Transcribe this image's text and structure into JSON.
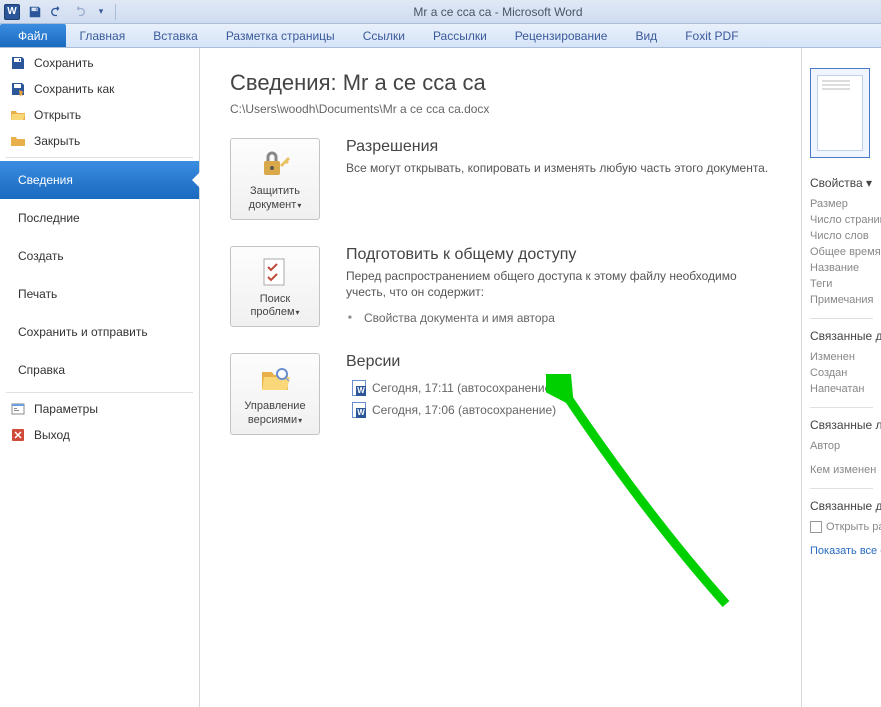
{
  "titlebar": {
    "doc_title": "Mr a ce  cca ca  -  Microsoft Word"
  },
  "ribbon": {
    "file": "Файл",
    "tabs": [
      "Главная",
      "Вставка",
      "Разметка страницы",
      "Ссылки",
      "Рассылки",
      "Рецензирование",
      "Вид",
      "Foxit PDF"
    ]
  },
  "sidebar": {
    "save": "Сохранить",
    "save_as": "Сохранить как",
    "open": "Открыть",
    "close": "Закрыть",
    "info": "Сведения",
    "recent": "Последние",
    "new": "Создать",
    "print": "Печать",
    "save_send": "Сохранить и отправить",
    "help": "Справка",
    "options": "Параметры",
    "exit": "Выход"
  },
  "content": {
    "title": "Сведения: Mr a ce  cca ca",
    "path": "C:\\Users\\woodh\\Documents\\Mr a ce  cca ca.docx",
    "permissions": {
      "btn": "Защитить документ",
      "heading": "Разрешения",
      "text": "Все могут открывать, копировать и изменять любую часть этого документа."
    },
    "prepare": {
      "btn": "Поиск проблем",
      "heading": "Подготовить к общему доступу",
      "text": "Перед распространением общего доступа к этому файлу необходимо учесть, что он содержит:",
      "bullets": [
        "Свойства документа и имя автора"
      ]
    },
    "versions": {
      "btn": "Управление версиями",
      "heading": "Версии",
      "items": [
        "Сегодня, 17:11 (автосохранение)",
        "Сегодня, 17:06 (автосохранение)"
      ]
    }
  },
  "rightpanel": {
    "props_heading": "Свойства",
    "size": "Размер",
    "pages": "Число страниц",
    "words": "Число слов",
    "edit_time": "Общее время",
    "name": "Название",
    "tags": "Теги",
    "comments": "Примечания",
    "related_dates": "Связанные даты",
    "modified": "Изменен",
    "created": "Создан",
    "printed": "Напечатан",
    "related_people": "Связанные люди",
    "author": "Автор",
    "last_modified_by": "Кем изменен",
    "related_docs": "Связанные документы",
    "open_location": "Открыть расположение",
    "show_all": "Показать все свойства"
  }
}
